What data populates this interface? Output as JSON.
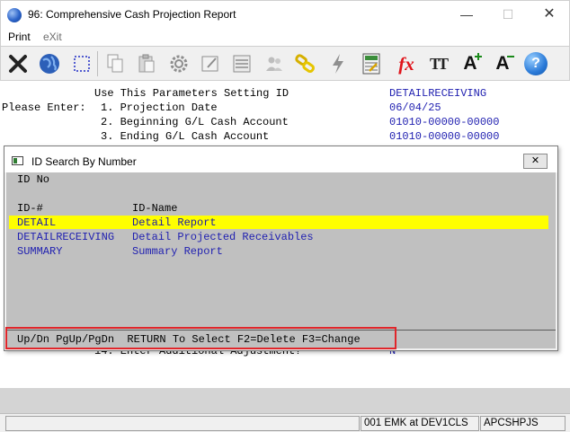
{
  "window": {
    "title": "96: Comprehensive Cash Projection Report",
    "minimize": "—",
    "maximize": "☐",
    "close": "✕"
  },
  "menu": {
    "print": "Print",
    "exit": "eXit"
  },
  "toolbar": {
    "icons": [
      "exit-x-icon",
      "globe-icon",
      "select-box-icon",
      "copy-icon",
      "paste-icon",
      "settings-gear-icon",
      "edit-form-icon",
      "list-icon",
      "users-icon",
      "chain-link-icon",
      "lightning-icon",
      "calculator-icon",
      "function-fx-icon",
      "font-size-icon",
      "increase-font-icon",
      "decrease-font-icon",
      "help-icon"
    ],
    "fx": "fx",
    "tt": "TT",
    "a_plus": "A",
    "a_minus": "A",
    "help": "?"
  },
  "params": {
    "header_label": "Use This Parameters Setting ID",
    "header_value": "DETAILRECEIVING",
    "prompt": "Please Enter:",
    "items": [
      {
        "label": "1. Projection Date",
        "value": "06/04/25"
      },
      {
        "label": "2. Beginning G/L Cash Account",
        "value": "01010-00000-00000"
      },
      {
        "label": "3. Ending G/L Cash Account",
        "value": "01010-00000-00000"
      }
    ],
    "item14": {
      "label": "14. Enter Additional Adjustment?",
      "value": "N"
    }
  },
  "dialog": {
    "title": "ID Search By Number",
    "close": "✕",
    "search_label": "ID No",
    "col_id": "ID-#",
    "col_name": "ID-Name",
    "rows": [
      {
        "id": "DETAIL",
        "name": "Detail Report"
      },
      {
        "id": "DETAILRECEIVING",
        "name": "Detail Projected Receivables"
      },
      {
        "id": "SUMMARY",
        "name": "Summary Report"
      }
    ],
    "footer": "Up/Dn PgUp/PgDn  RETURN To Select F2=Delete F3=Change"
  },
  "status": {
    "user": "001 EMK at DEV1CLS",
    "program": "APCSHPJS"
  },
  "colors": {
    "selected_row": "#ffff00",
    "value_text": "#1f1fb0",
    "highlight_box": "#e0262b"
  }
}
